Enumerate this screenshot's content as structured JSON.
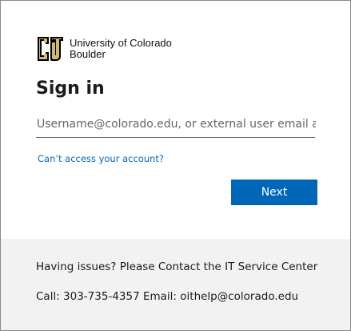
{
  "logo": {
    "line1": "University of Colorado",
    "line2": "Boulder"
  },
  "signin": {
    "title": "Sign in",
    "username_placeholder": "Username@colorado.edu, or external user email ad",
    "username_value": "",
    "cant_access_link": "Can’t access your account?",
    "next_label": "Next"
  },
  "footer": {
    "line1": "Having issues? Please Contact the IT Service Center",
    "line2": "Call: 303-735-4357 Email: oithelp@colorado.edu"
  },
  "colors": {
    "accent": "#0067b8",
    "footer_bg": "#f2f2f2",
    "logo_gold": "#cfb87c",
    "logo_black": "#000000"
  },
  "icons": {
    "logo": "cu-boulder-logo-icon"
  }
}
